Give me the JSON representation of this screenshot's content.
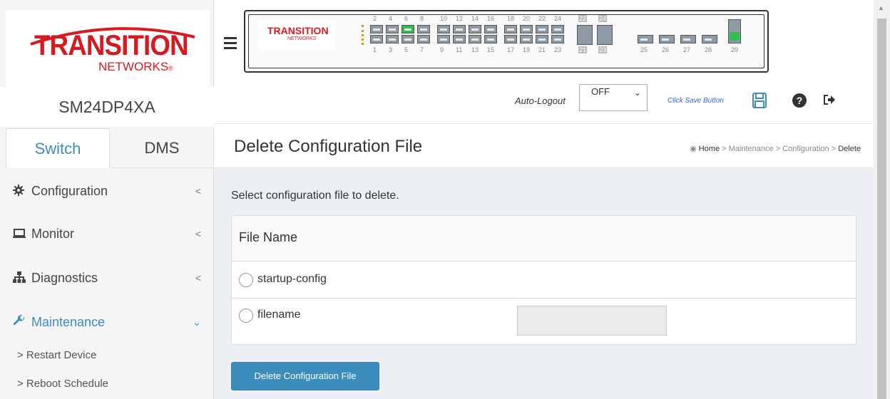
{
  "brand": {
    "line1": "TRANSITION",
    "line2": "NETWORKS",
    "mini_line1": "TRANSITION",
    "mini_line2": "NETWORKS"
  },
  "device_name": "SM24DP4XA",
  "tabs": [
    {
      "label": "Switch",
      "active": true
    },
    {
      "label": "DMS",
      "active": false
    }
  ],
  "nav": {
    "items": [
      {
        "label": "Configuration",
        "icon": "gear-icon",
        "chevron": "<"
      },
      {
        "label": "Monitor",
        "icon": "monitor-icon",
        "chevron": "<"
      },
      {
        "label": "Diagnostics",
        "icon": "sitemap-icon",
        "chevron": "<"
      },
      {
        "label": "Maintenance",
        "icon": "wrench-icon",
        "chevron": "v"
      }
    ],
    "sub_items": [
      {
        "label": "> Restart Device"
      },
      {
        "label": "> Reboot Schedule"
      }
    ]
  },
  "ports": {
    "top_labels": [
      "2",
      "4",
      "6",
      "8",
      "10",
      "12",
      "14",
      "16",
      "18",
      "20",
      "22",
      "24",
      "22",
      "24"
    ],
    "bottom_labels": [
      "1",
      "3",
      "5",
      "7",
      "9",
      "11",
      "13",
      "15",
      "17",
      "19",
      "21",
      "23",
      "21",
      "23",
      "25",
      "26",
      "27",
      "28",
      "29"
    ],
    "active_port_color": "#2fbf4f"
  },
  "toolbar": {
    "auto_logout_label": "Auto-Logout",
    "auto_logout_value": "OFF",
    "save_hint": "Click Save Button"
  },
  "page": {
    "title": "Delete Configuration File",
    "breadcrumb": {
      "home": "Home",
      "sep": ">",
      "items": [
        "Maintenance",
        "Configuration",
        "Delete"
      ]
    },
    "instruction": "Select configuration file to delete.",
    "table": {
      "header": "File Name",
      "rows": [
        {
          "label": "startup-config"
        },
        {
          "label": "filename"
        }
      ]
    },
    "delete_button": "Delete Configuration File"
  },
  "colors": {
    "accent": "#3c8dbc",
    "brand_red": "#d71920"
  }
}
